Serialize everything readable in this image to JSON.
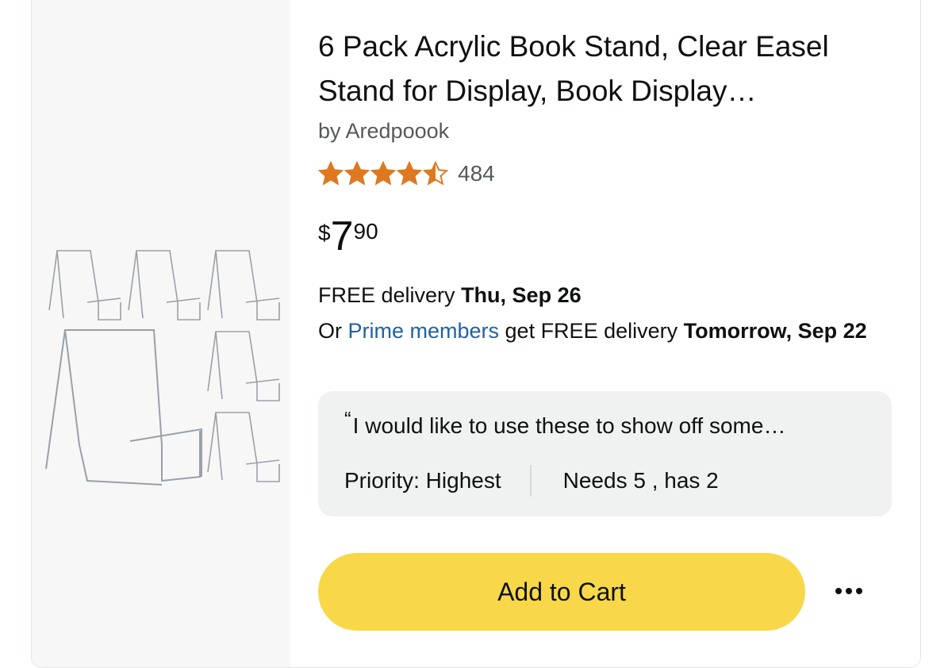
{
  "product": {
    "title": "6 Pack Acrylic Book Stand, Clear Easel Stand for Display, Book Display…",
    "byline": "by Aredpoook",
    "rating": 4.5,
    "rating_count": "484",
    "price": {
      "symbol": "$",
      "whole": "7",
      "fraction": "90"
    }
  },
  "delivery": {
    "line1_prefix": "FREE delivery ",
    "line1_date": "Thu, Sep 26",
    "line2_prefix": "Or ",
    "prime_link": "Prime members",
    "line2_middle": " get FREE delivery ",
    "line2_date": "Tomorrow, Sep 22"
  },
  "request_note": {
    "quote": "I would like to use these to show off some…",
    "priority": "Priority: Highest",
    "needs": "Needs 5 , has 2"
  },
  "actions": {
    "add_to_cart": "Add to Cart"
  },
  "colors": {
    "star": "#de7921",
    "cart_button": "#f8d849",
    "link": "#2162a1",
    "note_bg": "#f0f2f2"
  },
  "icons": {
    "rating": "star-icon",
    "more": "more-options-icon"
  }
}
